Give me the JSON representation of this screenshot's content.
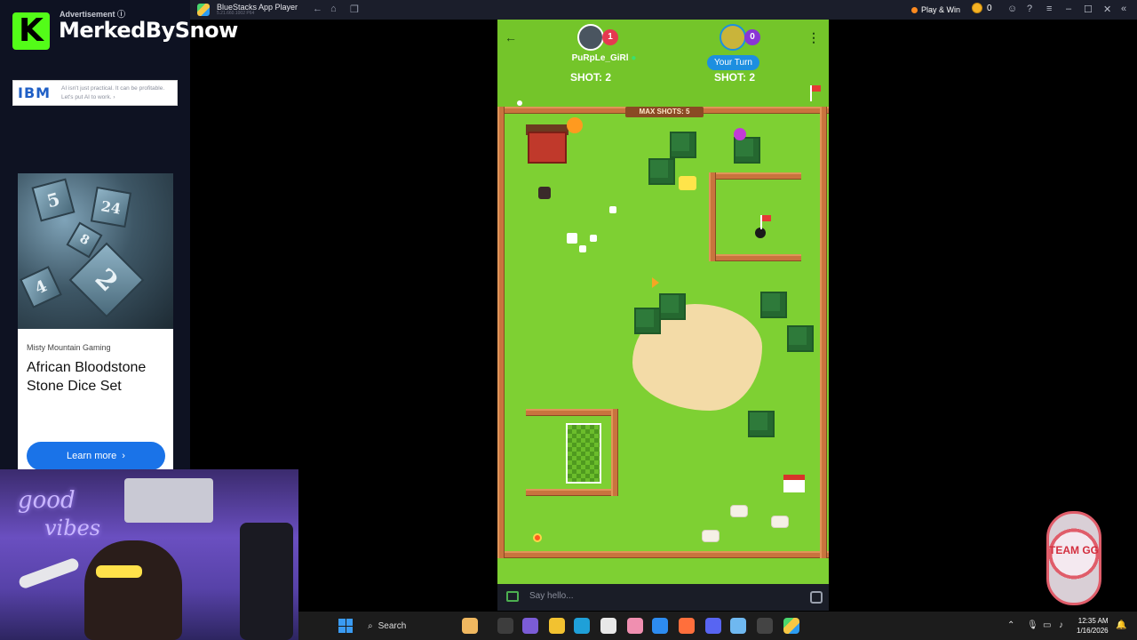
{
  "window": {
    "title": "BlueStacks App Player",
    "subtitle": "5.21.660.1002 P64",
    "play_win": "Play & Win",
    "coins": "0"
  },
  "overlay": {
    "streamer": "MerkedBySnow",
    "kick_letter": "K",
    "ad_label": "Advertisement ⓘ"
  },
  "ads": {
    "ibm_logo": "IBM",
    "ibm_text": "AI isn't just practical. It can be profitable. Let's put AI to work. ›",
    "brand": "Misty Mountain Gaming",
    "product": "African Bloodstone Stone Dice Set",
    "cta": "Learn more",
    "dice_numbers": [
      "5",
      "24",
      "8",
      "2",
      "4"
    ]
  },
  "webcam": {
    "neon_1": "good",
    "neon_2": "vibes"
  },
  "game": {
    "player1": {
      "name": "PuRpLe_GiRl",
      "score": "1",
      "shot": "SHOT: 2"
    },
    "player2": {
      "turn": "Your Turn",
      "score": "0",
      "shot": "SHOT: 2"
    },
    "max_shots": "MAX SHOTS: 5"
  },
  "chat": {
    "placeholder": "Say hello..."
  },
  "taskbar": {
    "search": "Search",
    "time": "12:35 AM",
    "date": "1/16/2026"
  },
  "sticker": {
    "text": "TEAM GG"
  },
  "colors": {
    "grass": "#7ed033",
    "fence": "#c9743e",
    "your_turn": "#1d8fe0",
    "kick_green": "#53fc18"
  }
}
